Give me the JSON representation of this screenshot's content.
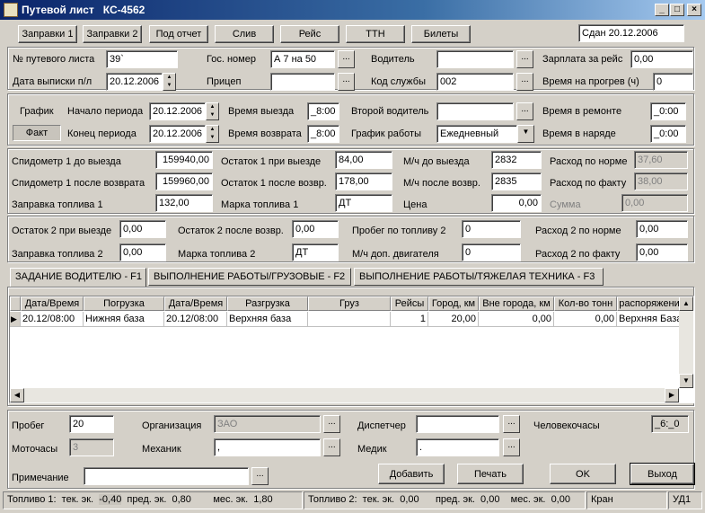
{
  "window": {
    "title": "Путевой лист   КС-4562",
    "min": "_",
    "max": "□",
    "close": "×"
  },
  "toolbar": {
    "b1": "Заправки 1",
    "b2": "Заправки 2",
    "b3": "Под отчет",
    "b4": "Слив",
    "b5": "Рейс",
    "b6": "ТТН",
    "b7": "Билеты",
    "sdan": "Сдан 20.12.2006"
  },
  "top": {
    "nomer_lbl": "№ путевого листа",
    "nomer": "39`",
    "data_lbl": "Дата выписки п/л",
    "data": "20.12.2006",
    "gos_lbl": "Гос. номер",
    "gos": "А   7 на 50",
    "pricep_lbl": "Прицеп",
    "pricep": "",
    "vod_lbl": "Водитель",
    "vod": "",
    "kod_lbl": "Код службы",
    "kod": "002",
    "zarp_lbl": "Зарплата за рейс",
    "zarp": "0,00",
    "progrev_lbl": "Время на прогрев (ч)",
    "progrev": "0"
  },
  "period": {
    "grafik": "График",
    "fakt": "Факт",
    "start_lbl": "Начало периода",
    "start": "20.12.2006",
    "end_lbl": "Конец периода",
    "end": "20.12.2006",
    "vyezd_lbl": "Время выезда",
    "vyezd": "_8:00",
    "vozvr_lbl": "Время возврата",
    "vozvr": "_8:00",
    "vod2_lbl": "Второй водитель",
    "vod2": "",
    "grafrab_lbl": "График работы",
    "grafrab": "Ежедневный",
    "remont_lbl": "Время в ремонте",
    "remont": "_0:00",
    "naryad_lbl": "Время в наряде",
    "naryad": "_0:00"
  },
  "fuel1": {
    "sp_do_lbl": "Спидометр 1 до выезда",
    "sp_do": "159940,00",
    "sp_posle_lbl": "Спидометр 1 после возврата",
    "sp_posle": "159960,00",
    "zapr_lbl": "Заправка топлива 1",
    "zapr": "132,00",
    "ost_vyezd_lbl": "Остаток 1 при выезде",
    "ost_vyezd": "84,00",
    "ost_posle_lbl": "Остаток 1 после возвр.",
    "ost_posle": "178,00",
    "marka_lbl": "Марка топлива 1",
    "marka": "ДТ",
    "mch_do_lbl": "М/ч до выезда",
    "mch_do": "2832",
    "mch_posle_lbl": "М/ч после возвр.",
    "mch_posle": "2835",
    "cena_lbl": "Цена",
    "cena": "0,00",
    "norm_lbl": "Расход по норме",
    "norm": "37,60",
    "fakt_lbl": "Расход по факту",
    "fakt": "38,00",
    "summa_lbl": "Сумма",
    "summa": "0,00"
  },
  "fuel2": {
    "ost_vyezd_lbl": "Остаток 2 при выезде",
    "ost_vyezd": "0,00",
    "zapr_lbl": "Заправка топлива 2",
    "zapr": "0,00",
    "ost_posle_lbl": "Остаток 2 после возвр.",
    "ost_posle": "0,00",
    "marka_lbl": "Марка топлива 2",
    "marka": "ДТ",
    "probeg_lbl": "Пробег по  топливу 2",
    "probeg": "0",
    "mch_lbl": "М/ч доп. двигателя",
    "mch": "0",
    "norm_lbl": "Расход 2 по норме",
    "norm": "0,00",
    "fakt_lbl": "Расход 2 по факту",
    "fakt": "0,00"
  },
  "tabs": [
    "ЗАДАНИЕ ВОДИТЕЛЮ - F1",
    "ВЫПОЛНЕНИЕ РАБОТЫ/ГРУЗОВЫЕ - F2",
    "ВЫПОЛНЕНИЕ РАБОТЫ/ТЯЖЕЛАЯ ТЕХНИКА - F3"
  ],
  "table": {
    "headers": [
      "Дата/Время",
      "Погрузка",
      "Дата/Время",
      "Разгрузка",
      "Груз",
      "Рейсы",
      "Город, км",
      "Вне города, км",
      "Кол-во тонн",
      "распоряжени"
    ],
    "row": [
      "20.12/08:00",
      "Нижняя база",
      "20.12/08:00",
      "Верхняя база",
      "",
      "1",
      "20,00",
      "0,00",
      "0,00",
      "Верхняя База"
    ]
  },
  "bottom": {
    "probeg_lbl": "Пробег",
    "probeg": "20",
    "moto_lbl": "Моточасы",
    "moto": "3",
    "org_lbl": "Организация",
    "org": "ЗАО",
    "meh_lbl": "Механик",
    "meh": ",",
    "disp_lbl": "Диспетчер",
    "disp": "",
    "medik_lbl": "Медик",
    "medik": ".",
    "chelchas_lbl": "Человекочасы",
    "chelchas": "_6:_0",
    "prim_lbl": "Примечание",
    "prim": "",
    "add": "Добавить",
    "print": "Печать",
    "ok": "OK",
    "exit": "Выход"
  },
  "status": {
    "s1": "Топливо 1:  тек. эк.  ",
    "s1v": "-0,40",
    "s1b": "  пред. эк.  0,80        мес. эк.  1,80",
    "s2": "Топливо 2:  тек. эк.  0,00      пред. эк.  0,00    мес. эк.  0,00",
    "s3": "Кран",
    "s4": "УД1"
  }
}
